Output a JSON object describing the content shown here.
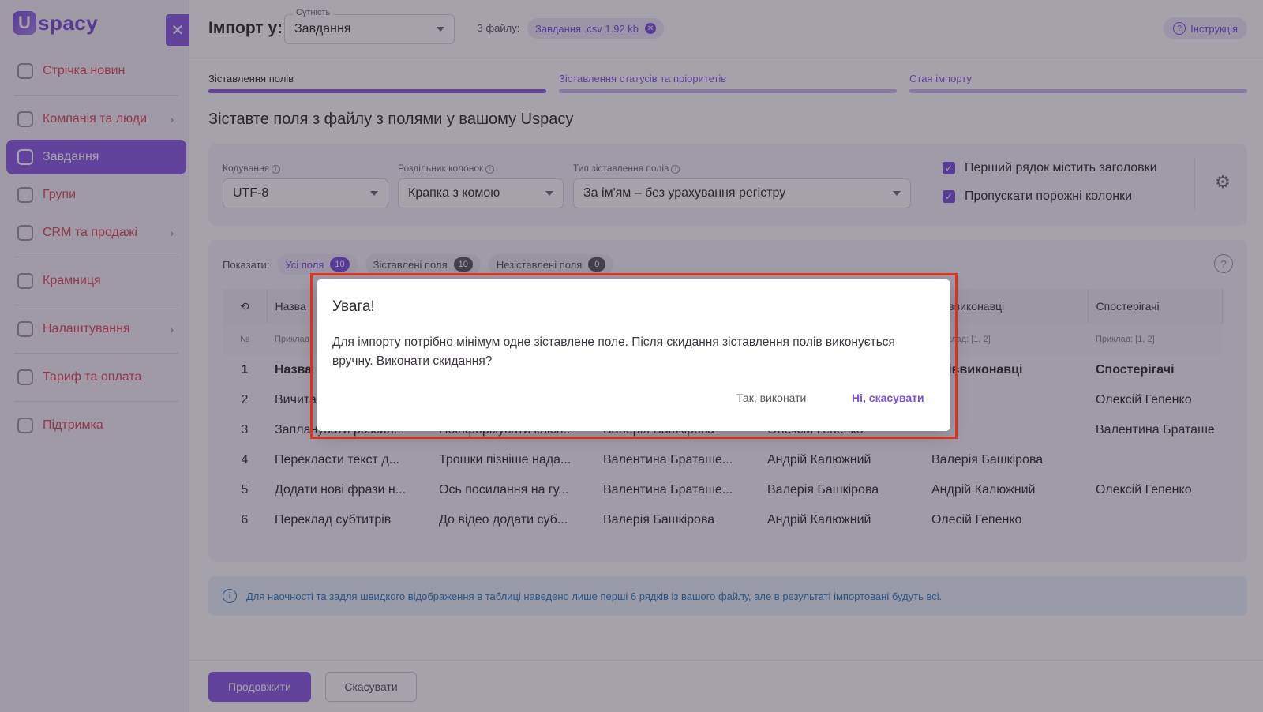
{
  "brand": {
    "logo_letter": "U",
    "logo_text": "spacy"
  },
  "sidebar": {
    "close": "✕",
    "items": [
      {
        "label": "Стрічка новин",
        "icon": "home-icon",
        "chevron": ""
      },
      {
        "label": "Компанія та люди",
        "icon": "building-icon",
        "chevron": "›"
      },
      {
        "label": "Завдання",
        "icon": "tasks-icon",
        "chevron": "",
        "active": true
      },
      {
        "label": "Групи",
        "icon": "users-icon",
        "chevron": ""
      },
      {
        "label": "CRM та продажі",
        "icon": "crm-icon",
        "chevron": "›"
      },
      {
        "label": "Крамниця",
        "icon": "store-icon",
        "chevron": ""
      },
      {
        "label": "Налаштування",
        "icon": "gear-icon",
        "chevron": "›"
      },
      {
        "label": "Тариф та оплата",
        "icon": "wallet-icon",
        "chevron": ""
      },
      {
        "label": "Підтримка",
        "icon": "support-icon",
        "chevron": ""
      }
    ]
  },
  "topbar": {
    "import_label": "Імпорт у:",
    "entity_label": "Сутність",
    "entity_value": "Завдання",
    "from_file_label": "З файлу:",
    "file_name": "Завдання .csv 1.92 kb",
    "file_remove": "✕",
    "instruction": "Інструкція"
  },
  "steps": [
    {
      "label": "Зіставлення полів"
    },
    {
      "label": "Зіставлення статусів та пріоритетів"
    },
    {
      "label": "Стан імпорту"
    }
  ],
  "heading": "Зіставте поля з файлу з полями у вашому Uspacy",
  "settings": {
    "encoding_label": "Кодування",
    "encoding_value": "UTF-8",
    "delimiter_label": "Роздільник колонок",
    "delimiter_value": "Крапка з комою",
    "mapping_label": "Тип зіставлення полів",
    "mapping_value": "За ім'ям – без урахування регістру",
    "first_row_headers": "Перший рядок містить заголовки",
    "skip_empty": "Пропускати порожні колонки"
  },
  "filters": {
    "show_label": "Показати:",
    "all": {
      "label": "Усі поля",
      "count": "10"
    },
    "mapped": {
      "label": "Зіставлені поля",
      "count": "10"
    },
    "unmapped": {
      "label": "Незіставлені поля",
      "count": "0"
    }
  },
  "table": {
    "headers": [
      "",
      "Назва",
      "",
      "",
      "",
      "Співвиконавці",
      "Спостерігачі"
    ],
    "example": [
      "№",
      "Приклад:",
      "",
      "",
      "",
      "Приклад: [1, 2]",
      "Приклад: [1, 2]"
    ],
    "rows": [
      [
        "1",
        "Назва",
        "",
        "",
        "",
        "Співвиконавці",
        "Спостерігачі"
      ],
      [
        "2",
        "Вичита",
        "",
        "",
        "",
        "",
        "Олексій Гепенко"
      ],
      [
        "3",
        "Запланувати розсил...",
        "Поінформувати клієн...",
        "Валерія Башкірова",
        "Олексій Гепенко",
        "",
        "Валентина Браташе"
      ],
      [
        "4",
        "Перекласти текст д...",
        "Трошки пізніше нада...",
        "Валентина Браташе...",
        "Андрій Калюжний",
        "Валерія Башкірова",
        ""
      ],
      [
        "5",
        "Додати нові фрази н...",
        "Ось посилання на гу...",
        "Валентина Браташе...",
        "Валерія Башкірова",
        "Андрій Калюжний",
        "Олексій Гепенко"
      ],
      [
        "6",
        "Переклад субтитрів",
        "До відео додати суб...",
        "Валерія Башкірова",
        "Андрій Калюжний",
        "Олесій Гепенко",
        ""
      ]
    ]
  },
  "note": "Для наочності та задля швидкого відображення в таблиці наведено лише перші 6 рядків із вашого файлу, але в результаті імпортовані будуть всі.",
  "footer": {
    "continue": "Продовжити",
    "cancel": "Скасувати"
  },
  "modal": {
    "title": "Увага!",
    "body": "Для імпорту потрібно мінімум одне зіставлене поле. Після скидання зіставлення полів виконується вручну. Виконати скидання?",
    "yes": "Так, виконати",
    "no": "Ні, скасувати"
  },
  "colors": {
    "accent": "#8a5ce6",
    "highlight": "#e8321e",
    "sidebar_text": "#e0495b"
  }
}
